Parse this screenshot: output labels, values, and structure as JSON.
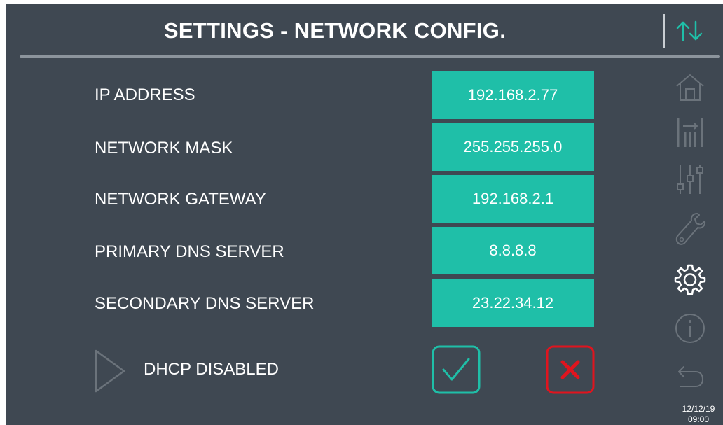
{
  "header": {
    "title": "SETTINGS - NETWORK CONFIG.",
    "sort_icon": "sort-up-down-icon"
  },
  "network": {
    "rows": [
      {
        "label": "IP ADDRESS",
        "value": "192.168.2.77"
      },
      {
        "label": "NETWORK MASK",
        "value": "255.255.255.0"
      },
      {
        "label": "NETWORK GATEWAY",
        "value": "192.168.2.1"
      },
      {
        "label": "PRIMARY DNS SERVER",
        "value": "8.8.8.8"
      },
      {
        "label": "SECONDARY DNS SERVER",
        "value": "23.22.34.12"
      }
    ]
  },
  "dhcp": {
    "label": "DHCP DISABLED",
    "icon": "play-triangle-icon"
  },
  "actions": {
    "confirm_icon": "check-icon",
    "cancel_icon": "close-x-icon"
  },
  "sidebar": {
    "items": [
      {
        "icon": "home-icon",
        "active": false
      },
      {
        "icon": "levels-icon",
        "active": false
      },
      {
        "icon": "sliders-icon",
        "active": false
      },
      {
        "icon": "wrench-icon",
        "active": false
      },
      {
        "icon": "gear-icon",
        "active": true
      },
      {
        "icon": "info-icon",
        "active": false
      },
      {
        "icon": "back-arrow-icon",
        "active": false
      }
    ]
  },
  "status": {
    "date": "12/12/19",
    "time": "09:00"
  },
  "colors": {
    "background": "#3f4852",
    "accent": "#1fbfa8",
    "confirm": "#1fbfa8",
    "cancel": "#e0141e",
    "icon_inactive": "#6b737b",
    "icon_active": "#ffffff"
  }
}
